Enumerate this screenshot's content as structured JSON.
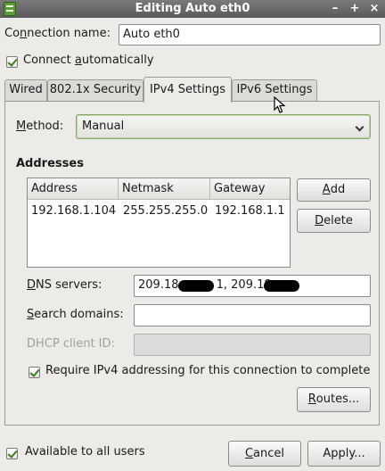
{
  "window": {
    "title": "Editing Auto eth0",
    "minimize_glyph": "–",
    "maximize_glyph": "+",
    "close_glyph": "×"
  },
  "connection_name": {
    "label_pre": "Co",
    "label_key": "n",
    "label_post": "nection name:",
    "value": "Auto eth0"
  },
  "connect_automatically": {
    "label_pre": "Connect ",
    "label_key": "a",
    "label_post": "utomatically",
    "checked": true
  },
  "tabs": [
    {
      "label": "Wired"
    },
    {
      "label": "802.1x Security"
    },
    {
      "label": "IPv4 Settings"
    },
    {
      "label": "IPv6 Settings"
    }
  ],
  "ipv4": {
    "method": {
      "label_pre": "",
      "label_key": "M",
      "label_post": "ethod:",
      "value": "Manual"
    },
    "addresses_heading": "Addresses",
    "table": {
      "headers": [
        "Address",
        "Netmask",
        "Gateway"
      ],
      "rows": [
        [
          "192.168.1.104",
          "255.255.255.0",
          "192.168.1.1"
        ]
      ]
    },
    "add_button": {
      "pre": "",
      "key": "A",
      "post": "dd"
    },
    "delete_button": {
      "pre": "",
      "key": "D",
      "post": "elete"
    },
    "dns": {
      "label_pre": "",
      "label_key": "D",
      "label_post": "NS servers:",
      "value_part1": "209.18.",
      "value_part2": "1, 209.18."
    },
    "search_domains": {
      "label_pre": "",
      "label_key": "S",
      "label_post": "earch domains:",
      "value": ""
    },
    "dhcp_client_id": {
      "label": "DHCP client ID:",
      "value": ""
    },
    "require_ipv4": {
      "label": "Require IPv4 addressing for this connection to complete",
      "checked": true
    },
    "routes_button": {
      "pre": "",
      "key": "R",
      "post": "outes..."
    }
  },
  "available_to_all_users": {
    "label": "Available to all users",
    "checked": true
  },
  "cancel_button": {
    "pre": "",
    "key": "C",
    "post": "ancel"
  },
  "apply_button": {
    "label": "Apply..."
  }
}
